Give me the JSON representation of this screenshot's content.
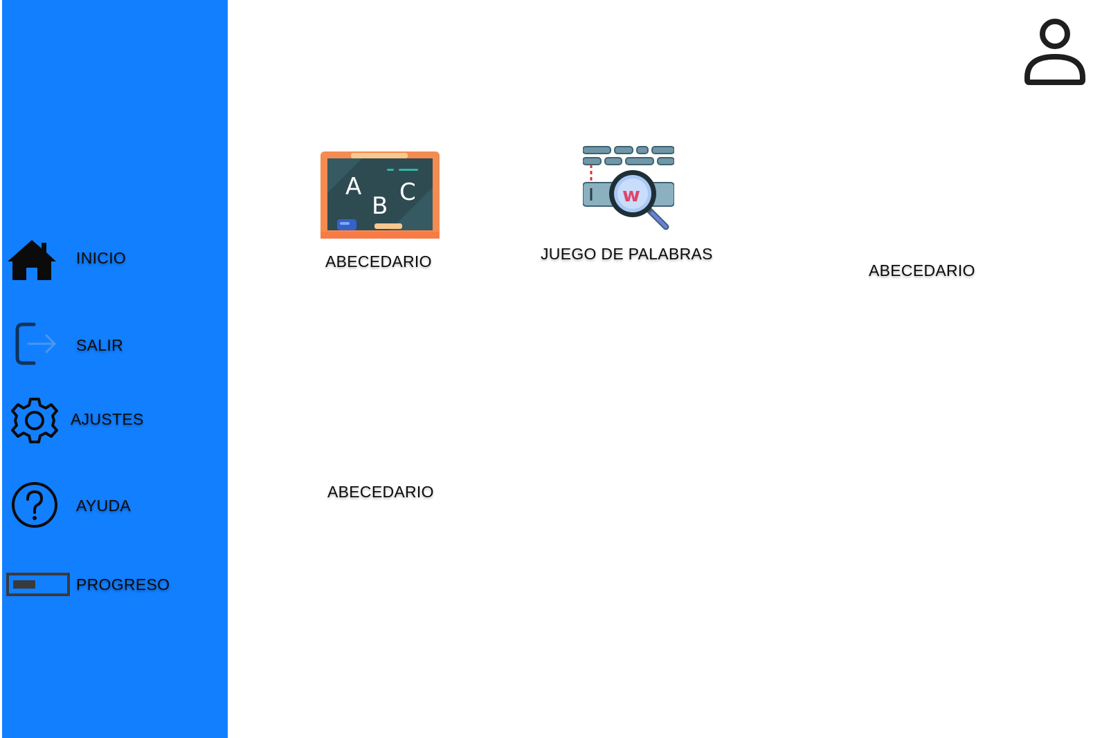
{
  "sidebar": {
    "background": "#127FFF",
    "items": [
      {
        "label": "INICIO",
        "icon": "home-icon"
      },
      {
        "label": "SALIR",
        "icon": "logout-icon"
      },
      {
        "label": "AJUSTES",
        "icon": "gear-icon"
      },
      {
        "label": "AYUDA",
        "icon": "help-icon"
      },
      {
        "label": "PROGRESO",
        "icon": "progress-bar-icon",
        "progress": 0.45
      }
    ]
  },
  "header": {
    "user_icon": "user-icon"
  },
  "main": {
    "cards": [
      {
        "label": "ABECEDARIO",
        "icon": "chalkboard-abc-icon"
      },
      {
        "label": "JUEGO DE PALABRAS",
        "icon": "word-search-icon"
      },
      {
        "label": "ABECEDARIO",
        "icon": ""
      },
      {
        "label": "ABECEDARIO",
        "icon": ""
      }
    ]
  },
  "colors": {
    "accent": "#127FFF",
    "text": "#0b0b0b",
    "icon": "#1a1a1a"
  }
}
